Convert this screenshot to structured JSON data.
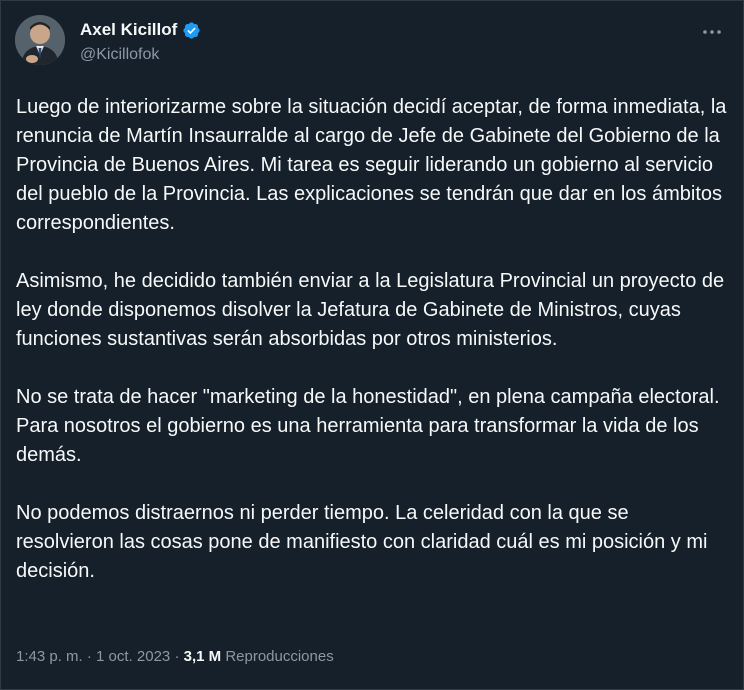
{
  "author": {
    "display_name": "Axel Kicillof",
    "handle": "@Kicillofok",
    "verified": true,
    "verified_color": "#1d9bf0",
    "avatar_icon": "profile-photo"
  },
  "actions": {
    "more_icon": "ellipsis-icon",
    "more_label": "···"
  },
  "tweet": {
    "paragraphs": [
      "Luego de interiorizarme sobre la situación decidí aceptar, de forma inmediata, la renuncia de Martín Insaurralde al cargo de Jefe de Gabinete del Gobierno de la Provincia de Buenos Aires. Mi tarea es seguir liderando un gobierno al servicio del pueblo de la Provincia. Las explicaciones se tendrán que dar en los ámbitos correspondientes.",
      "Asimismo, he decidido también enviar a la Legislatura Provincial un proyecto de ley donde disponemos disolver la Jefatura de Gabinete de Ministros, cuyas funciones sustantivas serán absorbidas por otros ministerios.",
      "No se trata de hacer \"marketing de la honestidad\", en plena campaña electoral. Para nosotros el gobierno es una herramienta para transformar la vida de los demás.",
      "No podemos distraernos ni perder tiempo. La celeridad con la que se resolvieron las cosas pone de manifiesto con claridad cuál es mi posición y mi decisión."
    ]
  },
  "meta": {
    "time": "1:43 p. m.",
    "separator": " · ",
    "date": "1 oct. 2023",
    "views_count": "3,1 M",
    "views_label": "Reproducciones"
  },
  "colors": {
    "background": "#15202b",
    "text_primary": "#f7f9f9",
    "text_secondary": "#8b98a5",
    "accent": "#1d9bf0"
  }
}
